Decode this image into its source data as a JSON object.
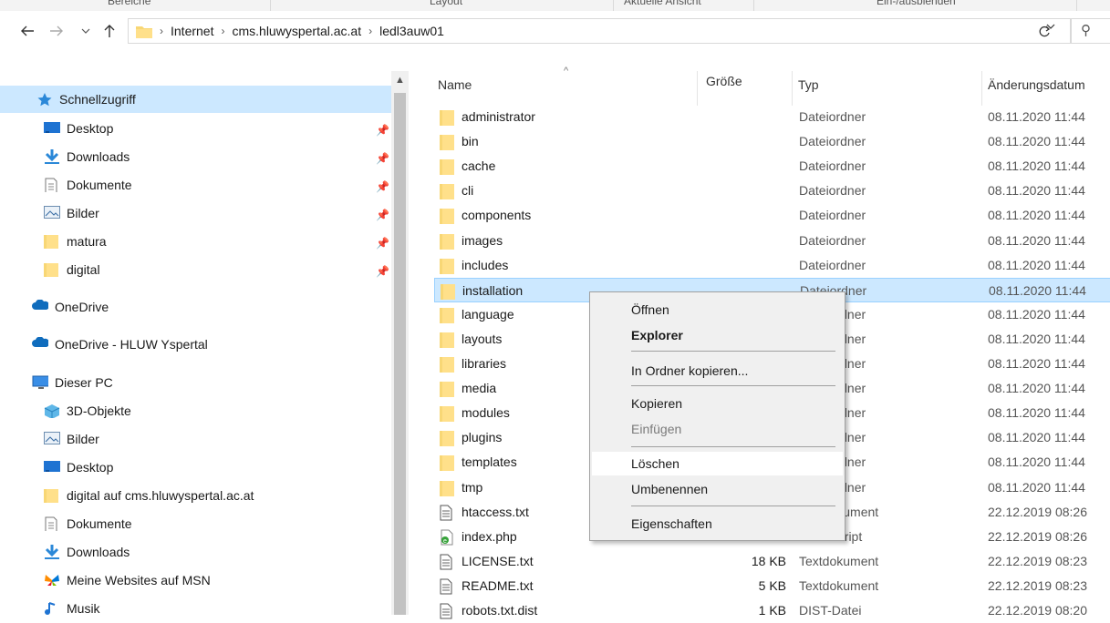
{
  "ribbon": {
    "groups": [
      "Bereiche",
      "Layout",
      "Aktuelle Ansicht",
      "Ein-/ausblenden"
    ]
  },
  "breadcrumb": [
    "Internet",
    "cms.hluwyspertal.ac.at",
    "ledl3auw01"
  ],
  "navpane": {
    "items": [
      {
        "label": "Schnellzugriff",
        "icon": "star-icon",
        "pinned": false
      },
      {
        "label": "Desktop",
        "icon": "desktop-icon",
        "pinned": true
      },
      {
        "label": "Downloads",
        "icon": "download-arrow-icon",
        "pinned": true
      },
      {
        "label": "Dokumente",
        "icon": "document-icon",
        "pinned": true
      },
      {
        "label": "Bilder",
        "icon": "pictures-icon",
        "pinned": true
      },
      {
        "label": "matura",
        "icon": "folder-icon",
        "pinned": true
      },
      {
        "label": "digital",
        "icon": "folder-icon",
        "pinned": true
      },
      {
        "label": "OneDrive",
        "icon": "cloud-icon",
        "pinned": false
      },
      {
        "label": "OneDrive - HLUW Yspertal",
        "icon": "cloud-icon",
        "pinned": false
      },
      {
        "label": "Dieser PC",
        "icon": "computer-icon",
        "pinned": false
      },
      {
        "label": "3D-Objekte",
        "icon": "cube-icon",
        "pinned": false
      },
      {
        "label": "Bilder",
        "icon": "pictures-icon",
        "pinned": false
      },
      {
        "label": "Desktop",
        "icon": "desktop-icon",
        "pinned": false
      },
      {
        "label": "digital auf cms.hluwyspertal.ac.at",
        "icon": "folder-icon",
        "pinned": false
      },
      {
        "label": "Dokumente",
        "icon": "document-icon",
        "pinned": false
      },
      {
        "label": "Downloads",
        "icon": "download-arrow-icon",
        "pinned": false
      },
      {
        "label": "Meine Websites auf MSN",
        "icon": "msn-butterfly-icon",
        "pinned": false
      },
      {
        "label": "Musik",
        "icon": "music-note-icon",
        "pinned": false
      }
    ]
  },
  "columns": {
    "name": "Name",
    "size": "Größe",
    "type": "Typ",
    "date": "Änderungsdatum"
  },
  "files": [
    {
      "name": "administrator",
      "size": "",
      "type": "Dateiordner",
      "date": "08.11.2020 11:44",
      "icon": "folder-icon"
    },
    {
      "name": "bin",
      "size": "",
      "type": "Dateiordner",
      "date": "08.11.2020 11:44",
      "icon": "folder-icon"
    },
    {
      "name": "cache",
      "size": "",
      "type": "Dateiordner",
      "date": "08.11.2020 11:44",
      "icon": "folder-icon"
    },
    {
      "name": "cli",
      "size": "",
      "type": "Dateiordner",
      "date": "08.11.2020 11:44",
      "icon": "folder-icon"
    },
    {
      "name": "components",
      "size": "",
      "type": "Dateiordner",
      "date": "08.11.2020 11:44",
      "icon": "folder-icon"
    },
    {
      "name": "images",
      "size": "",
      "type": "Dateiordner",
      "date": "08.11.2020 11:44",
      "icon": "folder-icon"
    },
    {
      "name": "includes",
      "size": "",
      "type": "Dateiordner",
      "date": "08.11.2020 11:44",
      "icon": "folder-icon"
    },
    {
      "name": "installation",
      "size": "",
      "type": "Dateiordner",
      "date": "08.11.2020 11:44",
      "icon": "folder-icon"
    },
    {
      "name": "language",
      "size": "",
      "type": "Dateiordner",
      "date": "08.11.2020 11:44",
      "icon": "folder-icon"
    },
    {
      "name": "layouts",
      "size": "",
      "type": "Dateiordner",
      "date": "08.11.2020 11:44",
      "icon": "folder-icon"
    },
    {
      "name": "libraries",
      "size": "",
      "type": "Dateiordner",
      "date": "08.11.2020 11:44",
      "icon": "folder-icon"
    },
    {
      "name": "media",
      "size": "",
      "type": "Dateiordner",
      "date": "08.11.2020 11:44",
      "icon": "folder-icon"
    },
    {
      "name": "modules",
      "size": "",
      "type": "Dateiordner",
      "date": "08.11.2020 11:44",
      "icon": "folder-icon"
    },
    {
      "name": "plugins",
      "size": "",
      "type": "Dateiordner",
      "date": "08.11.2020 11:44",
      "icon": "folder-icon"
    },
    {
      "name": "templates",
      "size": "",
      "type": "Dateiordner",
      "date": "08.11.2020 11:44",
      "icon": "folder-icon"
    },
    {
      "name": "tmp",
      "size": "",
      "type": "Dateiordner",
      "date": "08.11.2020 11:44",
      "icon": "folder-icon"
    },
    {
      "name": "htaccess.txt",
      "size": "",
      "type": "Textdokument",
      "date": "22.12.2019 08:26",
      "icon": "text-file-icon"
    },
    {
      "name": "index.php",
      "size": "",
      "type": "PHP-Skript",
      "date": "22.12.2019 08:26",
      "icon": "php-file-icon"
    },
    {
      "name": "LICENSE.txt",
      "size": "18 KB",
      "type": "Textdokument",
      "date": "22.12.2019 08:23",
      "icon": "text-file-icon"
    },
    {
      "name": "README.txt",
      "size": "5 KB",
      "type": "Textdokument",
      "date": "22.12.2019 08:23",
      "icon": "text-file-icon"
    },
    {
      "name": "robots.txt.dist",
      "size": "1 KB",
      "type": "DIST-Datei",
      "date": "22.12.2019 08:20",
      "icon": "text-file-icon"
    }
  ],
  "highlighted_file": "installation",
  "context_menu": {
    "items": [
      {
        "label": "Öffnen",
        "style": "normal"
      },
      {
        "label": "Explorer",
        "style": "bold"
      },
      {
        "label": "In Ordner kopieren...",
        "style": "normal"
      },
      {
        "label": "Kopieren",
        "style": "normal"
      },
      {
        "label": "Einfügen",
        "style": "disabled"
      },
      {
        "label": "Löschen",
        "style": "hover"
      },
      {
        "label": "Umbenennen",
        "style": "normal"
      },
      {
        "label": "Eigenschaften",
        "style": "normal"
      }
    ]
  },
  "colors": {
    "selection": "#cce8ff",
    "selection_border": "#99d1ff",
    "folder": "#f8d775",
    "accent_blue": "#0078d7"
  }
}
